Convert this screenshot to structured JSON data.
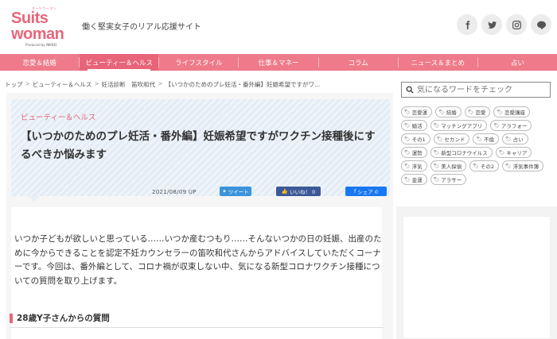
{
  "header": {
    "logo": {
      "top": "スーツウーマン",
      "line1": "Suits",
      "line2": "woman",
      "powered": "Produced by NIKKEI"
    },
    "tagline": "働く堅実女子のリアル応援サイト",
    "social": [
      {
        "name": "facebook-icon",
        "color": "#555555"
      },
      {
        "name": "twitter-icon",
        "color": "#555555"
      },
      {
        "name": "instagram-icon",
        "color": "#555555"
      },
      {
        "name": "line-icon",
        "color": "#555555"
      }
    ]
  },
  "nav": {
    "items": [
      "恋愛＆結婚",
      "ビューティー＆ヘルス",
      "ライフスタイル",
      "仕事＆マネー",
      "コラム",
      "ニュース＆まとめ",
      "占い"
    ],
    "active_index": 1,
    "color": "#ee7a8a"
  },
  "breadcrumb": [
    "トップ",
    "ビューティー＆ヘルス",
    "妊活診断　笛吹和代",
    "【いつかのためのプレ妊活・番外編】妊娠希望ですがワ..."
  ],
  "article": {
    "category": "ビューティー＆ヘルス",
    "title": "【いつかのためのプレ妊活・番外編】妊娠希望ですがワクチン接種後にするべきか悩みます",
    "date": "2021/08/09 UP",
    "tweet_label": "ツイート",
    "like_label": "いいね！ 0",
    "share_label": "シェア 0",
    "body": "いつか子どもが欲しいと思っている……いつか産むつもり……そんないつかの日の妊娠、出産のために今からできることを認定不妊カウンセラーの笛吹和代さんからアドバイスしていただくコーナーです。今回は、番外編として、コロナ禍が収束しない中、気になる新型コロナワクチン接種についての質問を取り上げます。",
    "question_heading": "28歳Y子さんからの質問"
  },
  "sidebar": {
    "search_placeholder": "気になるワードをチェック",
    "tags": [
      "恋愛運",
      "結婚",
      "恋愛",
      "恋愛講座",
      "婚活",
      "マッチングアプリ",
      "アラフォー",
      "その1",
      "セカンド",
      "不倫",
      "占い",
      "運勢",
      "新型コロナウイルス",
      "キャリア",
      "浮気",
      "美人探偵",
      "その2",
      "浮気事件簿",
      "金運",
      "アラサー"
    ]
  }
}
